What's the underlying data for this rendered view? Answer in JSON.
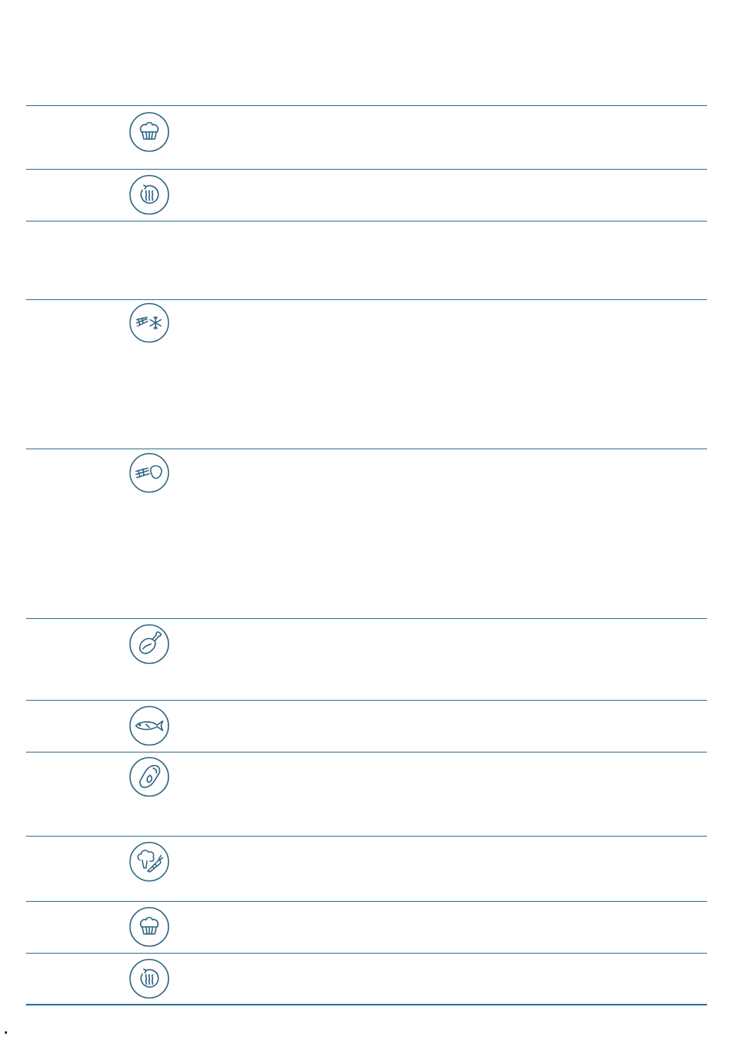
{
  "table": {
    "rows": [
      {
        "id": 1,
        "icon": "muffin-icon"
      },
      {
        "id": 2,
        "icon": "steam-cycle-icon"
      },
      {
        "id": 3,
        "icon": ""
      },
      {
        "id": 4,
        "icon": "frozen-vegetables-icon"
      },
      {
        "id": 5,
        "icon": "vegetables-meat-icon"
      },
      {
        "id": 6,
        "icon": "poultry-leg-icon"
      },
      {
        "id": 7,
        "icon": "fish-icon"
      },
      {
        "id": 8,
        "icon": "meat-steak-icon"
      },
      {
        "id": 9,
        "icon": "broccoli-carrot-icon"
      },
      {
        "id": 10,
        "icon": "muffin-icon"
      },
      {
        "id": 11,
        "icon": "steam-cycle-icon"
      }
    ]
  },
  "colors": {
    "rule": "#2f6f8f",
    "icon_stroke": "#2b6480",
    "bottom_rule": "#2a6f9a"
  }
}
